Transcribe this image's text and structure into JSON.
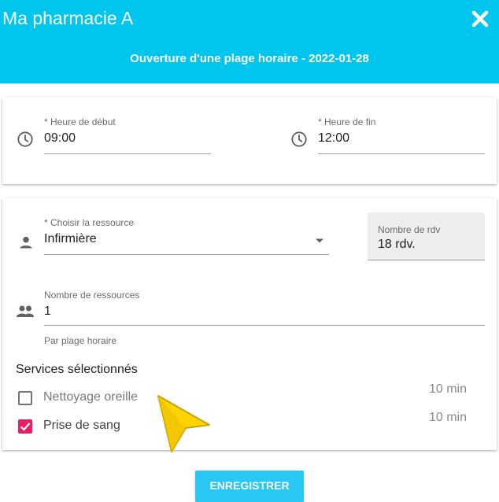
{
  "header": {
    "app_title": "Ma pharmacie A",
    "subtitle": "Ouverture d'une plage horaire - 2022-01-28",
    "close_icon": "close-icon",
    "background_color": "#00c6ef"
  },
  "time_range": {
    "start_label": "* Heure de début",
    "start_value": "09:00",
    "end_label": "* Heure de fin",
    "end_value": "12:00",
    "icon": "clock-icon"
  },
  "resource": {
    "select_label": "* Choisir la ressource",
    "select_value": "Infirmière",
    "icon": "person-icon",
    "rdv_label": "Nombre de rdv",
    "rdv_value": "18 rdv."
  },
  "resource_count": {
    "label": "Nombre de ressources",
    "value": "1",
    "helper": "Par plage horaire",
    "icon": "people-icon"
  },
  "services": {
    "title": "Services sélectionnés",
    "items": [
      {
        "name": "Nettoyage oreille",
        "duration": "10 min",
        "checked": false
      },
      {
        "name": "Prise de sang",
        "duration": "10 min",
        "checked": true
      }
    ]
  },
  "actions": {
    "save_label": "ENREGISTRER"
  }
}
